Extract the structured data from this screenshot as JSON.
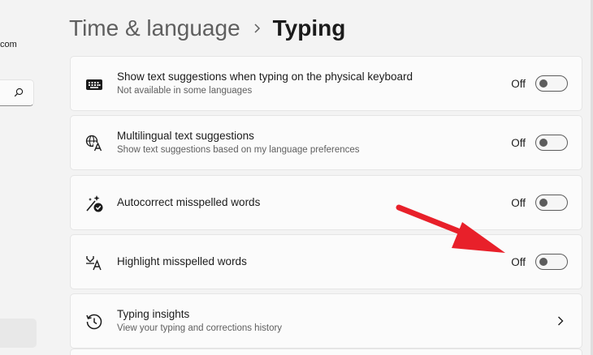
{
  "sidebar": {
    "email_fragment": "com"
  },
  "header": {
    "parent": "Time & language",
    "current": "Typing"
  },
  "settings": [
    {
      "icon": "keyboard-icon",
      "title": "Show text suggestions when typing on the physical keyboard",
      "subtitle": "Not available in some languages",
      "state": "Off"
    },
    {
      "icon": "translate-icon",
      "title": "Multilingual text suggestions",
      "subtitle": "Show text suggestions based on my language preferences",
      "state": "Off"
    },
    {
      "icon": "autocorrect-icon",
      "title": "Autocorrect misspelled words",
      "subtitle": "",
      "state": "Off"
    },
    {
      "icon": "highlight-spelling-icon",
      "title": "Highlight misspelled words",
      "subtitle": "",
      "state": "Off"
    },
    {
      "icon": "history-icon",
      "title": "Typing insights",
      "subtitle": "View your typing and corrections history"
    }
  ],
  "colors": {
    "annotation_arrow": "#e8202a",
    "toggle_off": "#5c5c5c",
    "card_bg": "#fbfbfb"
  }
}
